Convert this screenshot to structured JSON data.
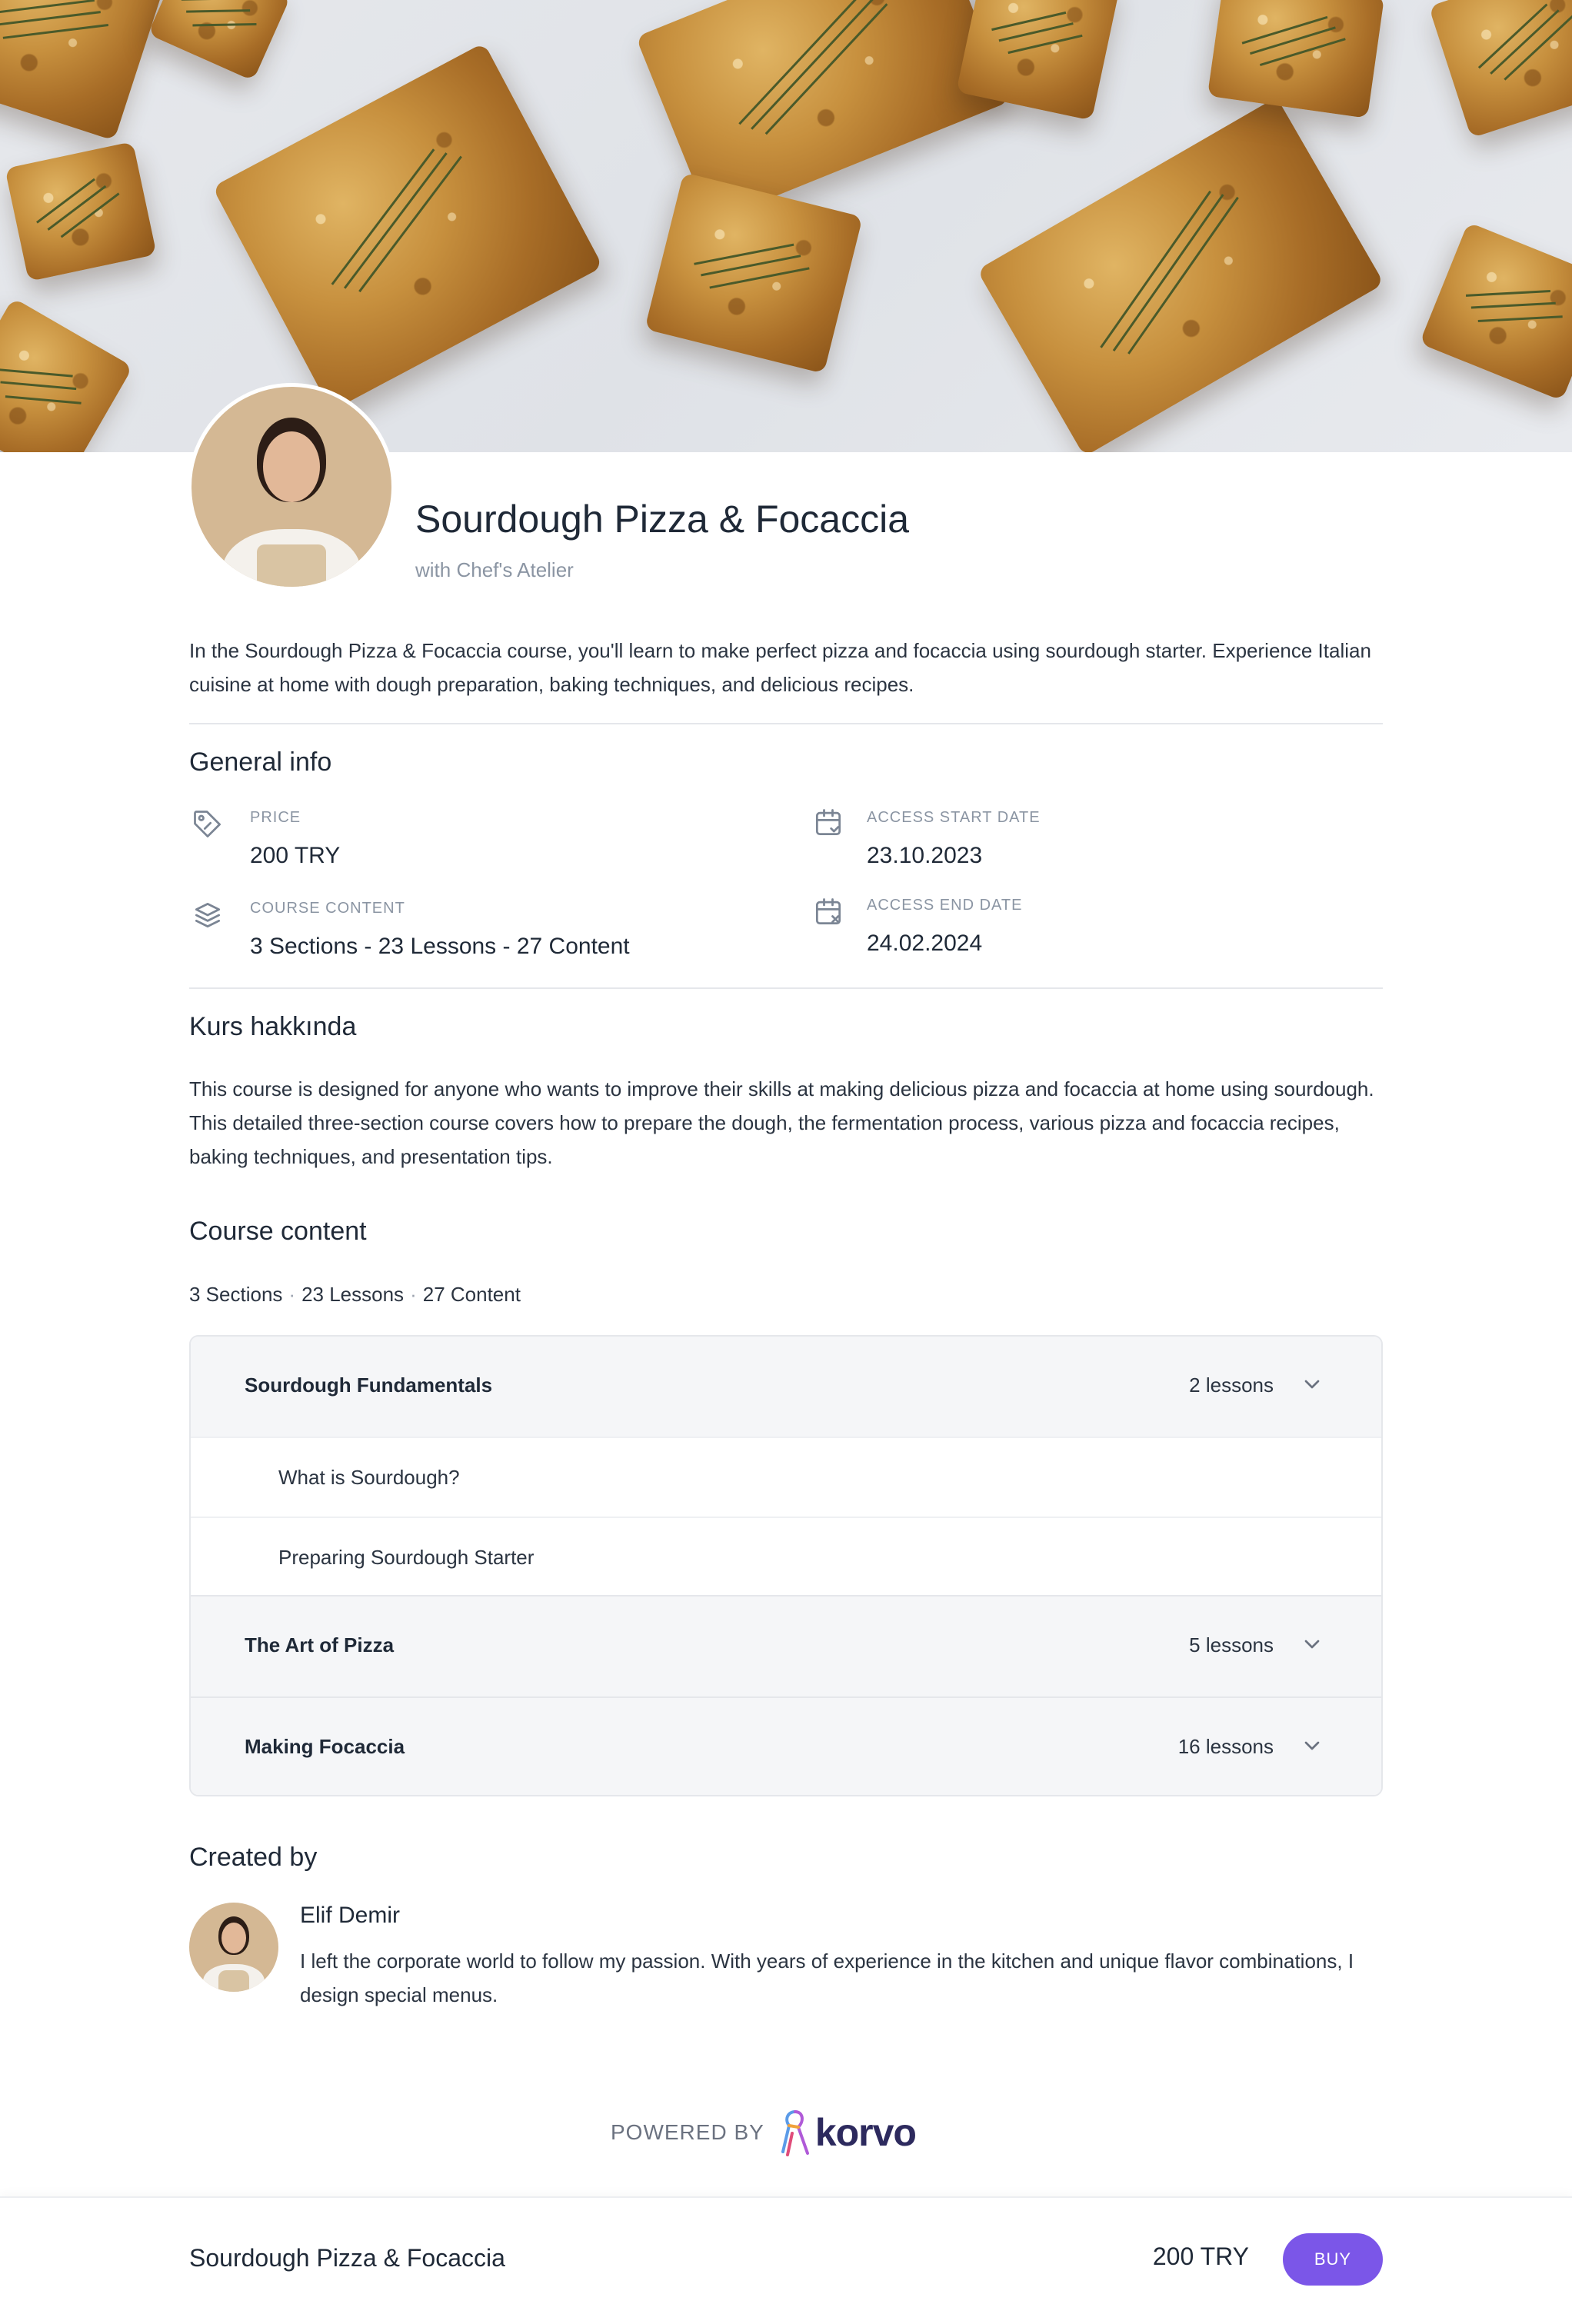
{
  "course": {
    "title": "Sourdough Pizza & Focaccia",
    "subtitle": "with Chef's Atelier",
    "description": "In the Sourdough Pizza & Focaccia course, you'll learn to make perfect pizza and focaccia using sourdough starter. Experience Italian cuisine at home with dough preparation, baking techniques, and delicious recipes."
  },
  "general_info": {
    "heading": "General info",
    "price_label": "PRICE",
    "price_value": "200 TRY",
    "content_label": "COURSE CONTENT",
    "content_value": "3 Sections - 23 Lessons - 27 Content",
    "start_label": "ACCESS START DATE",
    "start_value": "23.10.2023",
    "end_label": "ACCESS END DATE",
    "end_value": "24.02.2024",
    "icons": [
      "price-tag-icon",
      "layers-icon",
      "calendar-check-icon",
      "calendar-x-icon"
    ]
  },
  "about": {
    "heading": "Kurs hakkında",
    "text": "This course is designed for anyone who wants to improve their skills at making delicious pizza and focaccia at home using sourdough. This detailed three-section course covers how to prepare the dough, the fermentation process, various pizza and focaccia recipes, baking techniques, and presentation tips."
  },
  "course_content": {
    "heading": "Course content",
    "summary": {
      "sections": "3 Sections",
      "lessons": "23 Lessons",
      "content": "27 Content",
      "separator": "·"
    },
    "sections": [
      {
        "title": "Sourdough Fundamentals",
        "count": "2 lessons",
        "expanded": true,
        "lessons": [
          "What is Sourdough?",
          "Preparing Sourdough Starter"
        ]
      },
      {
        "title": "The Art of Pizza",
        "count": "5 lessons",
        "expanded": false
      },
      {
        "title": "Making Focaccia",
        "count": "16 lessons",
        "expanded": false
      }
    ]
  },
  "creator": {
    "heading": "Created by",
    "name": "Elif Demir",
    "bio": "I left the corporate world to follow my passion. With years of experience in the kitchen and unique flavor combinations, I design special menus."
  },
  "footer": {
    "powered_by": "POWERED BY",
    "brand": "korvo"
  },
  "bottom_bar": {
    "title": "Sourdough Pizza & Focaccia",
    "price": "200 TRY",
    "buy_label": "BUY"
  },
  "colors": {
    "accent": "#7b56e8",
    "text": "#1f2937",
    "muted": "#8b95a3",
    "section_bg": "#f5f6f8"
  }
}
